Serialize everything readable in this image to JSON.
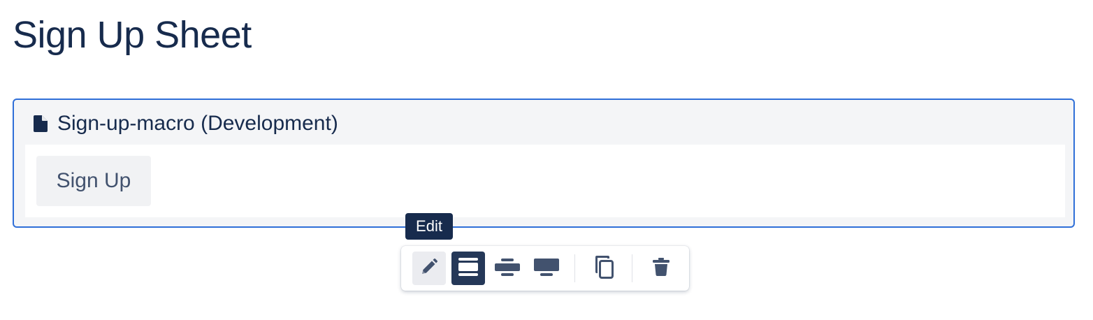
{
  "page": {
    "title": "Sign Up Sheet"
  },
  "macro": {
    "title": "Sign-up-macro (Development)",
    "icon": "document-icon",
    "button_label": "Sign Up"
  },
  "tooltip": {
    "text": "Edit"
  },
  "toolbar": {
    "buttons": [
      {
        "name": "edit",
        "icon": "pencil-icon",
        "state": "hover"
      },
      {
        "name": "layout-default",
        "icon": "full-width-icon",
        "state": "selected"
      },
      {
        "name": "layout-centered",
        "icon": "center-layout-icon",
        "state": "normal"
      },
      {
        "name": "layout-wide",
        "icon": "wide-layout-icon",
        "state": "normal"
      },
      {
        "name": "copy",
        "icon": "copy-icon",
        "state": "normal"
      },
      {
        "name": "delete",
        "icon": "trash-icon",
        "state": "normal"
      }
    ]
  },
  "colors": {
    "text_primary": "#172B4D",
    "text_secondary": "#42526E",
    "accent_border": "#2F6FD8",
    "selected_bg": "#253858",
    "icon": "#42526E"
  }
}
